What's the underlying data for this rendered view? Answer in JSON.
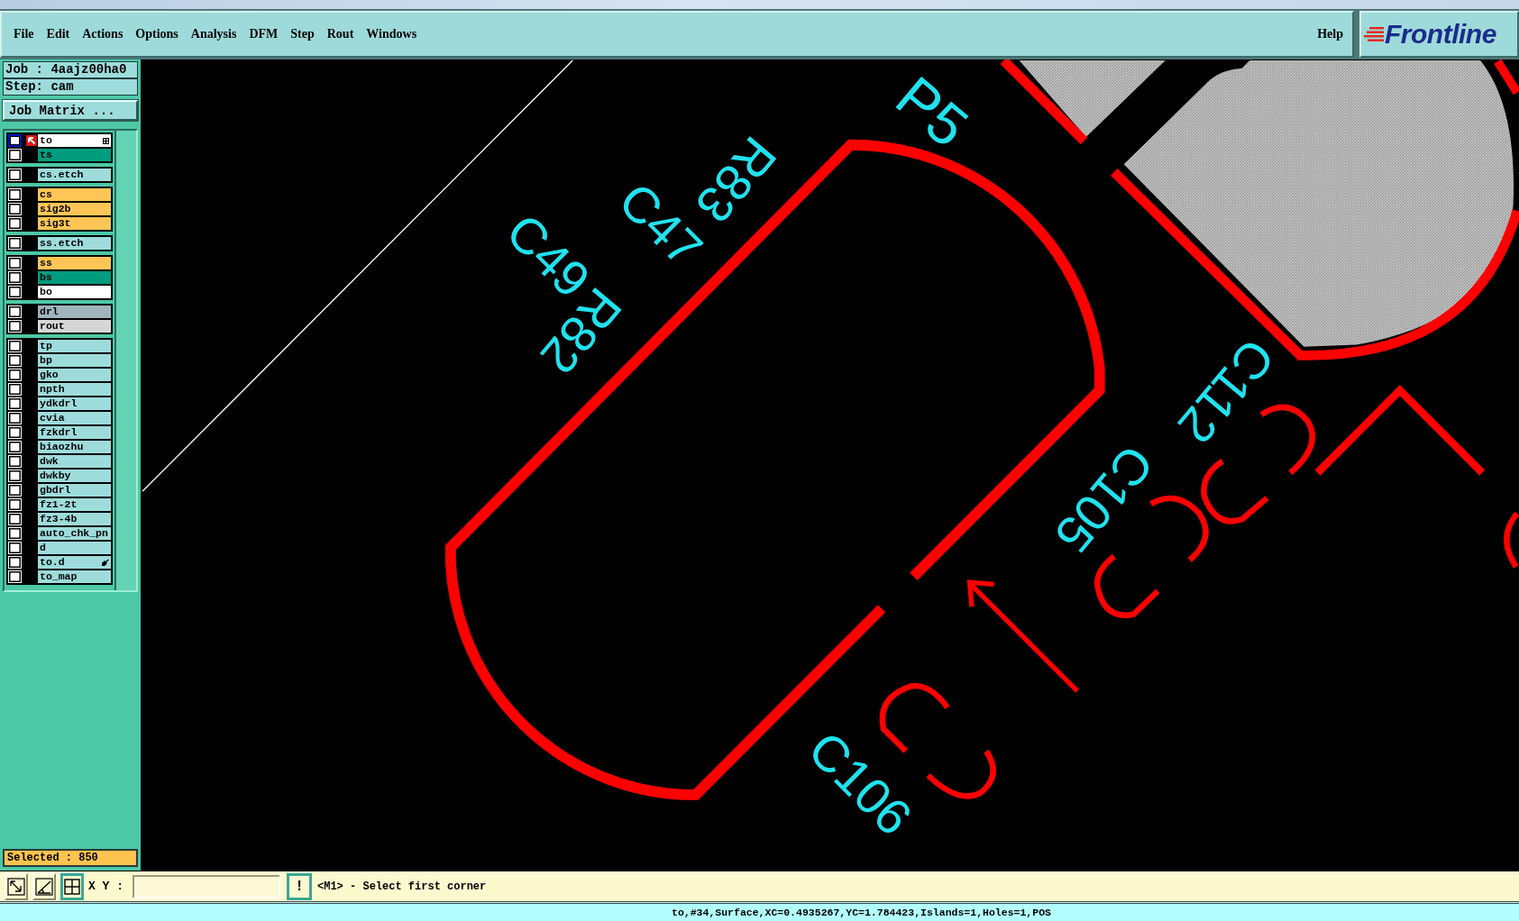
{
  "menu_bar": {
    "items": [
      "File",
      "Edit",
      "Actions",
      "Options",
      "Analysis",
      "DFM",
      "Step",
      "Rout",
      "Windows"
    ],
    "help": "Help"
  },
  "logo": {
    "text": "Frontline"
  },
  "job_panel": {
    "job": "Job : 4aajz00ha0",
    "step": "Step: cam",
    "matrix_button": "Job Matrix ..."
  },
  "layer_groups": [
    {
      "layers": [
        {
          "name": "to",
          "color": "#ffffff",
          "selected": true,
          "checked": false,
          "kind": "grid"
        },
        {
          "name": "ts",
          "color": "#009c7e",
          "selected": false,
          "checked": false,
          "kind": "plain"
        }
      ]
    },
    {
      "layers": [
        {
          "name": "cs.etch",
          "color": "#9edcdc",
          "selected": false,
          "checked": false,
          "kind": "plain"
        }
      ]
    },
    {
      "layers": [
        {
          "name": "cs",
          "color": "#ffc655",
          "selected": false,
          "checked": false,
          "kind": "plain"
        },
        {
          "name": "sig2b",
          "color": "#ffc655",
          "selected": false,
          "checked": false,
          "kind": "plain"
        },
        {
          "name": "sig3t",
          "color": "#ffc655",
          "selected": false,
          "checked": false,
          "kind": "plain"
        }
      ]
    },
    {
      "layers": [
        {
          "name": "ss.etch",
          "color": "#9edcdc",
          "selected": false,
          "checked": false,
          "kind": "plain"
        }
      ]
    },
    {
      "layers": [
        {
          "name": "ss",
          "color": "#ffc655",
          "selected": false,
          "checked": false,
          "kind": "plain"
        },
        {
          "name": "bs",
          "color": "#009c7e",
          "selected": false,
          "checked": false,
          "kind": "plain"
        },
        {
          "name": "bo",
          "color": "#ffffff",
          "selected": false,
          "checked": false,
          "kind": "plain"
        }
      ]
    },
    {
      "layers": [
        {
          "name": "drl",
          "color": "#9fb4bc",
          "selected": false,
          "checked": false,
          "kind": "plain"
        },
        {
          "name": "rout",
          "color": "#d6d6d6",
          "selected": false,
          "checked": false,
          "kind": "plain"
        }
      ]
    },
    {
      "layers": [
        {
          "name": "tp",
          "color": "#9edcdc",
          "selected": false,
          "checked": false,
          "kind": "plain"
        },
        {
          "name": "bp",
          "color": "#9edcdc",
          "selected": false,
          "checked": false,
          "kind": "plain"
        },
        {
          "name": "gko",
          "color": "#9edcdc",
          "selected": false,
          "checked": false,
          "kind": "plain"
        },
        {
          "name": "npth",
          "color": "#9edcdc",
          "selected": false,
          "checked": false,
          "kind": "plain"
        },
        {
          "name": "ydkdrl",
          "color": "#9edcdc",
          "selected": false,
          "checked": false,
          "kind": "plain"
        },
        {
          "name": "cvia",
          "color": "#9edcdc",
          "selected": false,
          "checked": false,
          "kind": "plain"
        },
        {
          "name": "fzkdrl",
          "color": "#9edcdc",
          "selected": false,
          "checked": false,
          "kind": "plain"
        },
        {
          "name": "biaozhu",
          "color": "#9edcdc",
          "selected": false,
          "checked": false,
          "kind": "plain"
        },
        {
          "name": "dwk",
          "color": "#9edcdc",
          "selected": false,
          "checked": false,
          "kind": "plain"
        },
        {
          "name": "dwkby",
          "color": "#9edcdc",
          "selected": false,
          "checked": false,
          "kind": "plain"
        },
        {
          "name": "gbdrl",
          "color": "#9edcdc",
          "selected": false,
          "checked": false,
          "kind": "plain"
        },
        {
          "name": "fz1-2t",
          "color": "#9edcdc",
          "selected": false,
          "checked": false,
          "kind": "plain"
        },
        {
          "name": "fz3-4b",
          "color": "#9edcdc",
          "selected": false,
          "checked": false,
          "kind": "plain"
        },
        {
          "name": "auto_chk_pn",
          "color": "#9edcdc",
          "selected": false,
          "checked": false,
          "kind": "plain"
        },
        {
          "name": "d",
          "color": "#9edcdc",
          "selected": false,
          "checked": false,
          "kind": "plain"
        },
        {
          "name": "to.d",
          "color": "#9edcdc",
          "selected": false,
          "checked": false,
          "kind": "hand"
        },
        {
          "name": "to_map",
          "color": "#9edcdc",
          "selected": false,
          "checked": false,
          "kind": "plain"
        }
      ]
    }
  ],
  "selection": {
    "text": "Selected : 850"
  },
  "canvas": {
    "labels": [
      "P5",
      "R83",
      "C47",
      "C49",
      "R82",
      "C112",
      "C105",
      "C106"
    ]
  },
  "toolbar": {
    "tool_buttons": [
      {
        "selected": false
      },
      {
        "selected": false
      },
      {
        "selected": true
      }
    ],
    "coord_label": "X Y :",
    "confirm_button": "!",
    "prompt": "<M1> - Select first corner"
  },
  "status_bar": {
    "text": "to,#34,Surface,XC=0.4935267,YC=1.784423,Islands=1,Holes=1,POS"
  }
}
